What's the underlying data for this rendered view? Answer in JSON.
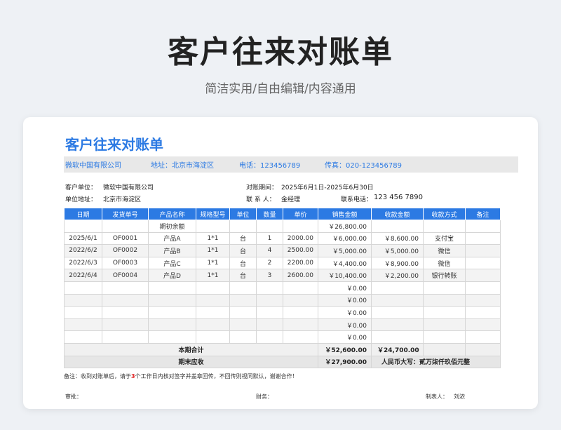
{
  "hero": {
    "title": "客户往来对账单",
    "subtitle": "简洁实用/自由编辑/内容通用"
  },
  "document": {
    "title": "客户往来对账单",
    "company": "微软中国有限公司",
    "address_label": "地址：",
    "address": "北京市海淀区",
    "phone_label": "电话：",
    "phone": "123456789",
    "fax_label": "传真：",
    "fax": "020-123456789"
  },
  "meta": {
    "customer_label": "客户单位：",
    "customer": "微软中国有限公司",
    "period_label": "对账期间：",
    "period": "2025年6月1日-2025年6月30日",
    "unit_address_label": "单位地址：",
    "unit_address": "北京市海淀区",
    "contact_label": "联 系 人：",
    "contact": "金经理",
    "contact_phone_label": "联系电话：",
    "contact_phone": "123 456 7890"
  },
  "table": {
    "headers": [
      "日期",
      "发货单号",
      "产品名称",
      "规格型号",
      "单位",
      "数量",
      "单价",
      "销售金额",
      "收款金额",
      "收款方式",
      "备注"
    ],
    "opening": {
      "label": "期初余额",
      "sales": "￥26,800.00"
    },
    "rows": [
      [
        "2025/6/1",
        "OF0001",
        "产品A",
        "1*1",
        "台",
        "1",
        "2000.00",
        "￥6,000.00",
        "￥8,600.00",
        "支付宝",
        ""
      ],
      [
        "2022/6/2",
        "OF0002",
        "产品B",
        "1*1",
        "台",
        "4",
        "2500.00",
        "￥5,000.00",
        "￥5,000.00",
        "微信",
        ""
      ],
      [
        "2022/6/3",
        "OF0003",
        "产品C",
        "1*1",
        "台",
        "2",
        "2200.00",
        "￥4,400.00",
        "￥8,900.00",
        "微信",
        ""
      ],
      [
        "2022/6/4",
        "OF0004",
        "产品D",
        "1*1",
        "台",
        "3",
        "2600.00",
        "￥10,400.00",
        "￥2,200.00",
        "银行转账",
        ""
      ],
      [
        "",
        "",
        "",
        "",
        "",
        "",
        "",
        "￥0.00",
        "",
        "",
        ""
      ],
      [
        "",
        "",
        "",
        "",
        "",
        "",
        "",
        "￥0.00",
        "",
        "",
        ""
      ],
      [
        "",
        "",
        "",
        "",
        "",
        "",
        "",
        "￥0.00",
        "",
        "",
        ""
      ],
      [
        "",
        "",
        "",
        "",
        "",
        "",
        "",
        "￥0.00",
        "",
        "",
        ""
      ],
      [
        "",
        "",
        "",
        "",
        "",
        "",
        "",
        "￥0.00",
        "",
        "",
        ""
      ]
    ],
    "total": {
      "label": "本期合计",
      "sales": "￥52,600.00",
      "received": "￥24,700.00"
    },
    "due": {
      "label": "期末应收",
      "amount": "￥27,900.00",
      "rmb_label": "人民币大写：",
      "rmb": "贰万柒仟玖佰元整"
    }
  },
  "remark": {
    "before": "备注：收到对账单后，请于",
    "days": "3",
    "after": "个工作日内核对签字并盖章回传，不回传则视同默认，谢谢合作！"
  },
  "signs": {
    "review": "审批：",
    "finance": "财务：",
    "maker_label": "制表人：",
    "maker": "刘浓"
  },
  "colors": {
    "accent": "#2c7ae3",
    "highlight": "#e02020"
  }
}
